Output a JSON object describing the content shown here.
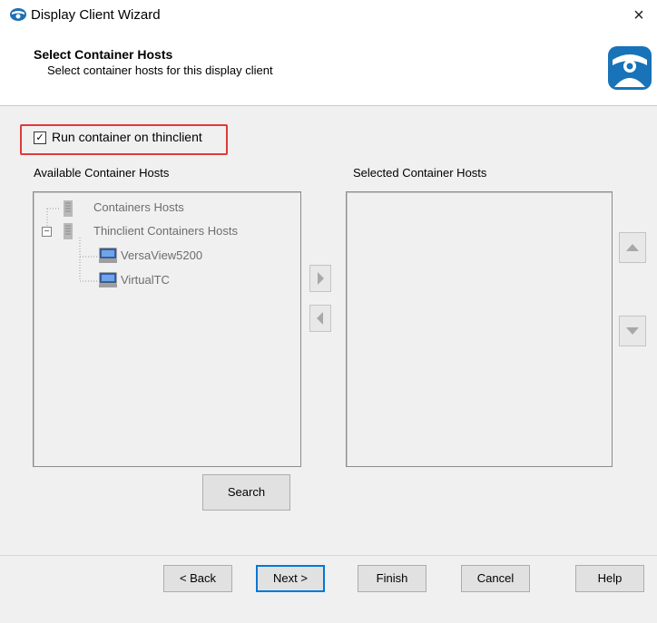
{
  "window": {
    "title": "Display Client Wizard",
    "close_label": "×"
  },
  "header": {
    "title": "Select Container Hosts",
    "subtitle": "Select container hosts for this display client"
  },
  "checkbox": {
    "label": "Run container on thinclient",
    "checked": true,
    "mark": "✓"
  },
  "available": {
    "label": "Available Container Hosts",
    "tree": [
      {
        "label": "Containers Hosts",
        "icon": "server-icon"
      },
      {
        "label": "Thinclient Containers Hosts",
        "icon": "server-icon",
        "expanded": true,
        "expander": "−"
      },
      {
        "label": "VersaView5200",
        "icon": "monitor-icon"
      },
      {
        "label": "VirtualTC",
        "icon": "monitor-icon"
      }
    ]
  },
  "selected": {
    "label": "Selected Container Hosts",
    "items": []
  },
  "buttons": {
    "search": "Search",
    "back": "< Back",
    "next": "Next >",
    "finish": "Finish",
    "cancel": "Cancel",
    "help": "Help"
  },
  "colors": {
    "highlight": "#e03a3a",
    "accent": "#0078d7",
    "logo": "#1873b8"
  }
}
